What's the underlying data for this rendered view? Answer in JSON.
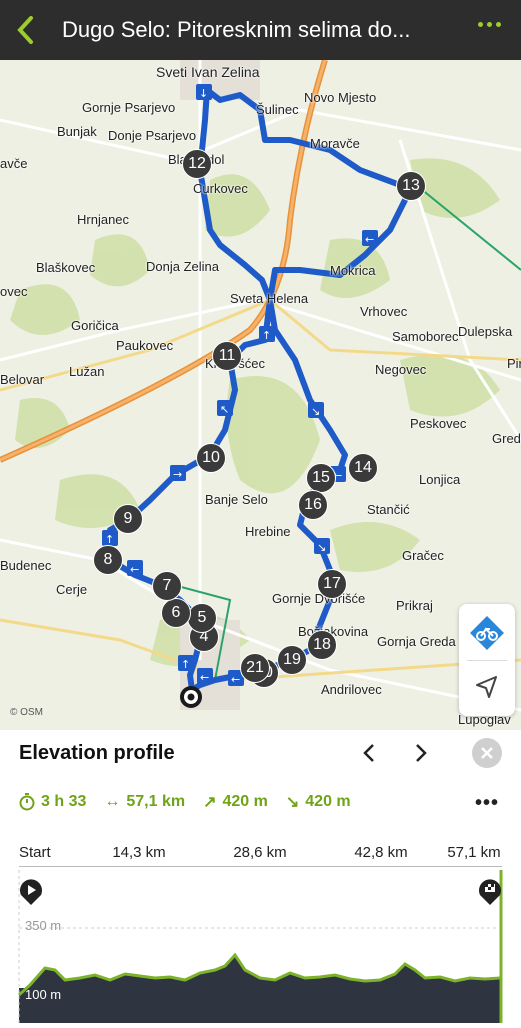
{
  "header": {
    "title": "Dugo Selo: Pitoresknim selima do...",
    "back_icon": "chevron-left-icon",
    "more_icon": "more-dots-icon"
  },
  "map": {
    "places": [
      "Sveti Ivan Zelina",
      "Gornje Psarjevo",
      "Novo Mjesto",
      "Bunjak",
      "Donje Psarjevo",
      "Blaževdol",
      "avče",
      "Curkovec",
      "Hrnjanec",
      "Blaškovec",
      "Donja Zelina",
      "Goričica",
      "Sveta Helena",
      "Vrhovec",
      "Samoborec",
      "Dulepska",
      "Paukovec",
      "Belovar",
      "Lužan",
      "Negovec",
      "Peskovec",
      "Lonjica",
      "Banje Selo",
      "Stančić",
      "Hrebine",
      "Budenec",
      "Cerje",
      "Gračec",
      "Gornje Dvorišće",
      "Prikraj",
      "Gornja Greda",
      "Božjakovina",
      "Andrilovec",
      "Lupoglav",
      "Kladešćec",
      "Moravče",
      "Šulinec",
      "Mokrica",
      "ovec",
      "Gred",
      "Pir"
    ],
    "waypoints": [
      "4",
      "5",
      "6",
      "7",
      "8",
      "9",
      "10",
      "11",
      "12",
      "13",
      "14",
      "15",
      "16",
      "17",
      "18",
      "19",
      "20",
      "21"
    ],
    "attribution": "© OSM",
    "route_color": "#1f5bc8"
  },
  "controls": {
    "bike_icon": "bike-icon",
    "locate_icon": "navigation-arrow-icon"
  },
  "panel": {
    "title": "Elevation profile",
    "prev_icon": "chevron-left-icon",
    "next_icon": "chevron-right-icon",
    "close_icon": "close-icon",
    "stats": {
      "duration": "3 h 33",
      "distance": "57,1 km",
      "ascent": "420 m",
      "descent": "420 m"
    },
    "more_icon": "more-dots-icon",
    "axis": {
      "start": "Start",
      "t1": "14,3 km",
      "t2": "28,6 km",
      "t3": "42,8 km",
      "end": "57,1 km"
    },
    "y_labels": {
      "high": "350 m",
      "low": "100 m"
    },
    "start_icon": "play-icon",
    "finish_icon": "finish-flag-icon",
    "accent": "#7cb32a"
  }
}
